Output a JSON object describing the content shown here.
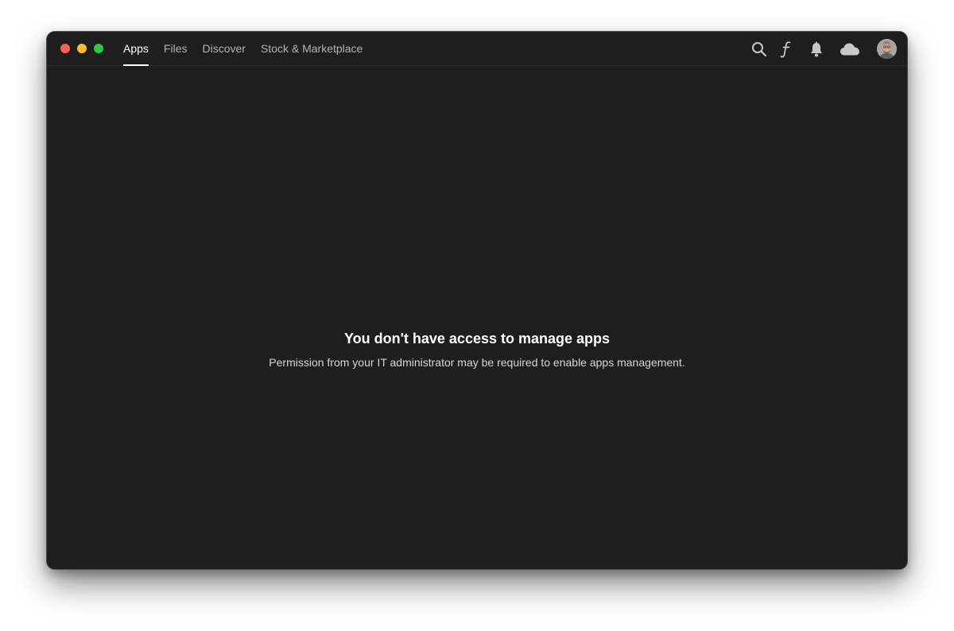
{
  "tabs": [
    {
      "label": "Apps",
      "active": true
    },
    {
      "label": "Files",
      "active": false
    },
    {
      "label": "Discover",
      "active": false
    },
    {
      "label": "Stock & Marketplace",
      "active": false
    }
  ],
  "header_icons": [
    "search-icon",
    "fonts-icon",
    "bell-icon",
    "cloud-icon"
  ],
  "message": {
    "title": "You don't have access to manage apps",
    "body": "Permission from your IT administrator may be required to enable apps management."
  },
  "colors": {
    "window_bg": "#1e1e1e",
    "text_primary": "#ffffff",
    "text_secondary": "#b3b3b3",
    "close": "#fe5f57",
    "minimize": "#febc2e",
    "maximize": "#28c840"
  }
}
